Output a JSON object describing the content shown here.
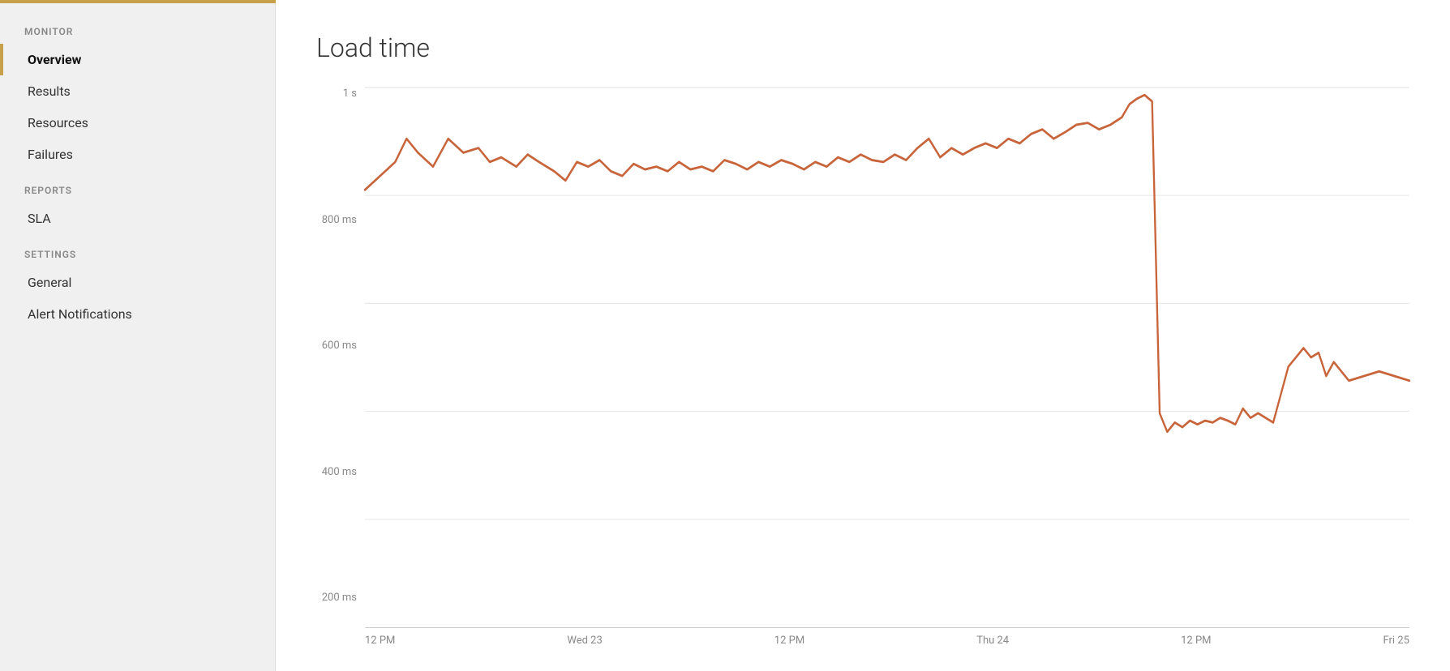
{
  "top_bar_color": "#c8a04a",
  "sidebar": {
    "sections": [
      {
        "label": "MONITOR",
        "items": [
          {
            "id": "overview",
            "label": "Overview",
            "active": true
          },
          {
            "id": "results",
            "label": "Results",
            "active": false
          },
          {
            "id": "resources",
            "label": "Resources",
            "active": false
          },
          {
            "id": "failures",
            "label": "Failures",
            "active": false
          }
        ]
      },
      {
        "label": "REPORTS",
        "items": [
          {
            "id": "sla",
            "label": "SLA",
            "active": false
          }
        ]
      },
      {
        "label": "SETTINGS",
        "items": [
          {
            "id": "general",
            "label": "General",
            "active": false
          },
          {
            "id": "alert-notifications",
            "label": "Alert Notifications",
            "active": false
          }
        ]
      }
    ]
  },
  "chart": {
    "title": "Load time",
    "y_labels": [
      "1 s",
      "800 ms",
      "600 ms",
      "400 ms",
      "200 ms"
    ],
    "x_labels": [
      "12 PM",
      "Wed 23",
      "12 PM",
      "Thu 24",
      "12 PM",
      "Fri 25"
    ],
    "line_color": "#c8643a",
    "line_color_fade": "#d4917a"
  }
}
